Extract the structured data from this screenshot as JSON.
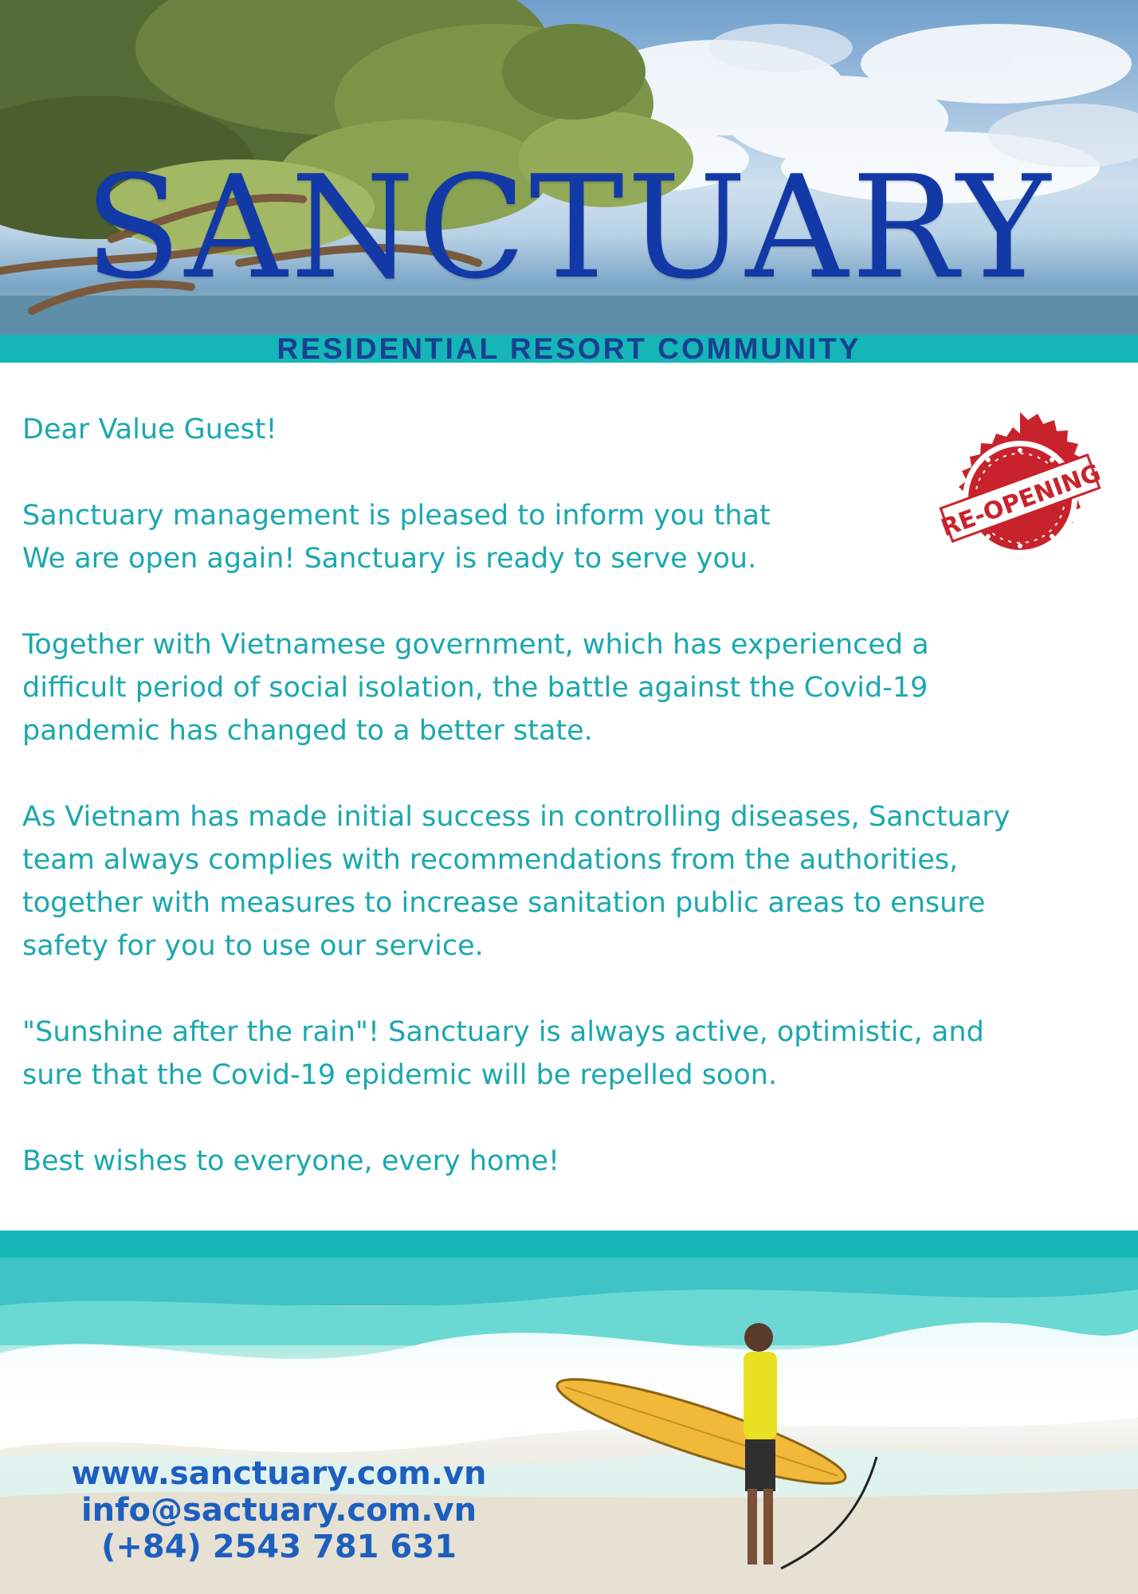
{
  "header": {
    "brand": "SANCTUARY",
    "tagline": "RESIDENTIAL RESORT COMMUNITY",
    "colors": {
      "brand": "#1239a6",
      "band": "#16b5b8",
      "tagline": "#1a3f8f"
    }
  },
  "stamp": {
    "text": "RE-OPENING",
    "color": "#c8232c",
    "icon": "reopening-stamp"
  },
  "letter": {
    "color": "#1aa8ae",
    "greeting": "Dear Value Guest!",
    "paragraphs": [
      "Sanctuary management is pleased to inform you that\nWe are open again! Sanctuary is ready to serve you.",
      "Together  with Vietnamese government, which has experienced a\ndifficult period of social isolation, the battle against the Covid-19\npandemic has changed to a better state.",
      "As Vietnam has made initial success in controlling diseases, Sanctuary\nteam always complies with recommendations from the authorities,\ntogether with measures to increase sanitation public areas to ensure\nsafety for you to use our service.",
      "\"Sunshine after the rain\"! Sanctuary is always active, optimistic, and\nsure that the Covid-19 epidemic will be repelled soon."
    ],
    "closing": "Best wishes  to everyone, every home!"
  },
  "footer": {
    "website": "www.sanctuary.com.vn",
    "email": "info@sactuary.com.vn",
    "phone": "(+84) 2543 781 631",
    "color": "#1d5fbf",
    "photo": "surfer-on-beach-image"
  }
}
